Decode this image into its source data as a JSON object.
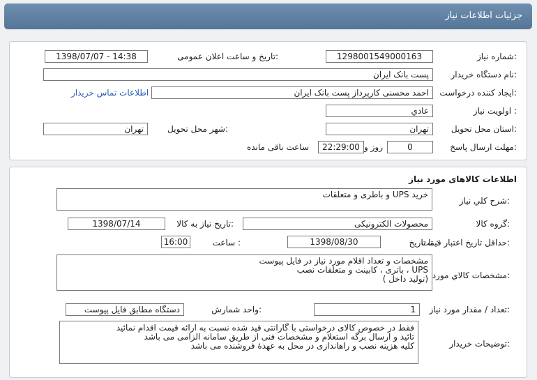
{
  "header": {
    "title": "جزئیات اطلاعات نیاز"
  },
  "need_info": {
    "need_number_label": "شماره نیاز:",
    "need_number": "1298001549000163",
    "announce_label": "تاریخ و ساعت اعلان عمومی:",
    "announce_value": "1398/07/07 - 14:38",
    "buyer_org_label": "نام دستگاه خریدار:",
    "buyer_org": "پست بانک ایران",
    "requester_label": "ایجاد کننده درخواست:",
    "requester": "احمد  محسنی کارپرداز پست بانک ایران",
    "contact_link": "اطلاعات تماس خریدار",
    "priority_label": "اولویت نیاز :",
    "priority": "عادي",
    "province_label": "استان محل تحویل:",
    "province": "تهران",
    "city_label": "شهر محل تحویل:",
    "city": "تهران",
    "deadline_label": "مهلت ارسال پاسخ:",
    "deadline_days": "0",
    "days_and": "روز و",
    "deadline_time": "22:29:00",
    "remaining": "ساعت باقی مانده"
  },
  "goods": {
    "section_title": "اطلاعات کالاهای مورد نیاز",
    "summary_label": "شرح کلي نیاز:",
    "summary": "خرید UPS و باطری و متعلقات",
    "group_label": "گروه کالا:",
    "group": "محصولات الکترونیکی",
    "need_date_label": "تاریخ نیاز به کالا:",
    "need_date": "1398/07/14",
    "validity_label": "حداقل تاریخ اعتبار قیمت:",
    "until_date_label": "تا تاریخ :",
    "validity_date": "1398/08/30",
    "hour_label": "ساعت :",
    "validity_time": "16:00",
    "specs_label": "مشخصات کالاي مورد نیاز:",
    "specs": [
      "مشخصات و تعداد اقلام مورد نیاز در فایل پیوست",
      "UPS ، باتری ، کابینت و متعلقات نصب",
      "(تولید داخل )"
    ],
    "qty_label": "تعداد / مقدار مورد نیاز:",
    "qty": "1",
    "unit_label": "واحد شمارش:",
    "unit": "دستگاه مطابق فایل پیوست",
    "buyer_notes_label": "توضیحات خریدار:",
    "buyer_notes": [
      "فقط در خصوص کالای درخواستی با گارانتی قید شده نسبت به ارائه قیمت اقدام نمائید",
      "تائید و ارسال برگه استعلام و مشخصات فنی از طریق سامانه الزامی می باشد",
      "کلیه هزینه نصب و راهاندازی در محل به عهدهٔ فروشنده می باشد"
    ]
  }
}
